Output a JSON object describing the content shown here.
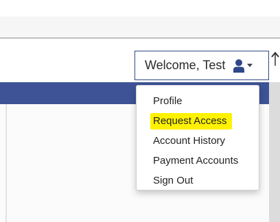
{
  "user_menu": {
    "welcome_text": "Welcome, Test",
    "user_icon": "user-icon",
    "caret_icon": "caret-down-icon"
  },
  "dropdown": {
    "items": [
      {
        "label": "Profile"
      },
      {
        "label": "Request Access",
        "highlighted": true
      },
      {
        "label": "Account History"
      },
      {
        "label": "Payment Accounts"
      },
      {
        "label": "Sign Out"
      }
    ]
  },
  "colors": {
    "navbar": "#3d5396",
    "button_border": "#2f4688",
    "user_icon": "#2f4688",
    "highlight": "#fff200"
  }
}
